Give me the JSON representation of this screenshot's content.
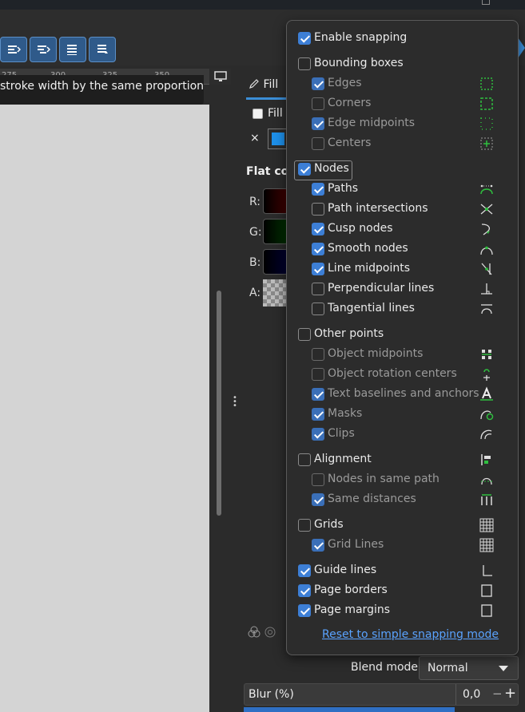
{
  "tooltip": {
    "text": "stroke width by the same proportion"
  },
  "ruler": {
    "ticks": [
      "275",
      "300",
      "325",
      "350"
    ]
  },
  "panel": {
    "tab_fill": "Fill",
    "subtab_fill": "Fill",
    "flat_color_label": "Flat col",
    "channels": [
      "R:",
      "G:",
      "B:",
      "A:"
    ],
    "blend_label": "Blend mode:",
    "blend_value": "Normal",
    "blur_label": "Blur (%)",
    "blur_value": "0,0",
    "close_symbol": "×"
  },
  "snapping": {
    "enable": {
      "label": "Enable snapping",
      "checked": true
    },
    "groups": [
      {
        "label": "Bounding boxes",
        "checked": false,
        "items": [
          {
            "label": "Edges",
            "checked": true,
            "icon": "bbox-edges-icon"
          },
          {
            "label": "Corners",
            "checked": false,
            "icon": "bbox-corners-icon"
          },
          {
            "label": "Edge midpoints",
            "checked": true,
            "icon": "bbox-edge-midpoints-icon"
          },
          {
            "label": "Centers",
            "checked": false,
            "icon": "bbox-centers-icon"
          }
        ]
      },
      {
        "label": "Nodes",
        "checked": true,
        "items": [
          {
            "label": "Paths",
            "checked": true,
            "icon": "paths-icon"
          },
          {
            "label": "Path intersections",
            "checked": false,
            "icon": "path-intersections-icon"
          },
          {
            "label": "Cusp nodes",
            "checked": true,
            "icon": "cusp-nodes-icon"
          },
          {
            "label": "Smooth nodes",
            "checked": true,
            "icon": "smooth-nodes-icon"
          },
          {
            "label": "Line midpoints",
            "checked": true,
            "icon": "line-midpoints-icon"
          },
          {
            "label": "Perpendicular lines",
            "checked": false,
            "icon": "perpendicular-lines-icon"
          },
          {
            "label": "Tangential lines",
            "checked": false,
            "icon": "tangential-lines-icon"
          }
        ]
      },
      {
        "label": "Other points",
        "checked": false,
        "items": [
          {
            "label": "Object midpoints",
            "checked": false,
            "icon": "object-midpoints-icon"
          },
          {
            "label": "Object rotation centers",
            "checked": false,
            "icon": "rotation-centers-icon"
          },
          {
            "label": "Text baselines and anchors",
            "checked": true,
            "icon": "text-baselines-icon"
          },
          {
            "label": "Masks",
            "checked": true,
            "icon": "masks-icon"
          },
          {
            "label": "Clips",
            "checked": true,
            "icon": "clips-icon"
          }
        ]
      },
      {
        "label": "Alignment",
        "checked": false,
        "icon": "alignment-icon",
        "items": [
          {
            "label": "Nodes in same path",
            "checked": false,
            "icon": "nodes-same-path-icon"
          },
          {
            "label": "Same distances",
            "checked": true,
            "icon": "same-distances-icon"
          }
        ]
      },
      {
        "label": "Grids",
        "checked": false,
        "icon": "grids-icon",
        "items": [
          {
            "label": "Grid Lines",
            "checked": true,
            "icon": "grid-lines-icon"
          }
        ]
      }
    ],
    "guide_lines": {
      "label": "Guide lines",
      "checked": true,
      "icon": "guide-lines-icon"
    },
    "page_borders": {
      "label": "Page borders",
      "checked": true,
      "icon": "page-borders-icon"
    },
    "page_margins": {
      "label": "Page margins",
      "checked": true,
      "icon": "page-margins-icon"
    },
    "reset_link": "Reset to simple snapping mode"
  },
  "colors": {
    "accent": "#3d7fd6",
    "snap_green": "#2fbf3f",
    "link": "#5aa3ff"
  }
}
